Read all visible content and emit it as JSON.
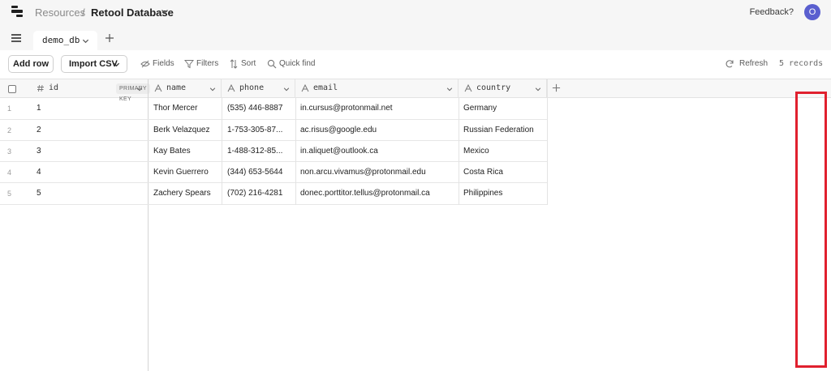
{
  "breadcrumb": {
    "root": "Resources",
    "separator": "/",
    "current": "Retool Database"
  },
  "header": {
    "feedback": "Feedback?",
    "avatar_initial": "O"
  },
  "tabs": [
    {
      "label": "demo_db"
    }
  ],
  "toolbar": {
    "add_row": "Add row",
    "import_csv": "Import CSV",
    "fields": "Fields",
    "filters": "Filters",
    "sort": "Sort",
    "quick_find": "Quick find",
    "refresh": "Refresh",
    "records": "5 records"
  },
  "table": {
    "columns": [
      {
        "name": "id",
        "type_icon": "hash-icon",
        "badge": "PRIMARY KEY"
      },
      {
        "name": "name",
        "type_icon": "text-type-icon"
      },
      {
        "name": "phone",
        "type_icon": "text-type-icon"
      },
      {
        "name": "email",
        "type_icon": "text-type-icon"
      },
      {
        "name": "country",
        "type_icon": "text-type-icon"
      }
    ],
    "rows": [
      {
        "num": "1",
        "id": "1",
        "name": "Thor Mercer",
        "phone": "(535) 446-8887",
        "email": "in.cursus@protonmail.net",
        "country": "Germany"
      },
      {
        "num": "2",
        "id": "2",
        "name": "Berk Velazquez",
        "phone": "1-753-305-87...",
        "email": "ac.risus@google.edu",
        "country": "Russian Federation"
      },
      {
        "num": "3",
        "id": "3",
        "name": "Kay Bates",
        "phone": "1-488-312-85...",
        "email": "in.aliquet@outlook.ca",
        "country": "Mexico"
      },
      {
        "num": "4",
        "id": "4",
        "name": "Kevin Guerrero",
        "phone": "(344) 653-5644",
        "email": "non.arcu.vivamus@protonmail.edu",
        "country": "Costa Rica"
      },
      {
        "num": "5",
        "id": "5",
        "name": "Zachery Spears",
        "phone": "(702) 216-4281",
        "email": "donec.porttitor.tellus@protonmail.ca",
        "country": "Philippines"
      }
    ]
  },
  "colors": {
    "accent_avatar": "#5a5fcf",
    "highlight_box": "#e0202e"
  }
}
